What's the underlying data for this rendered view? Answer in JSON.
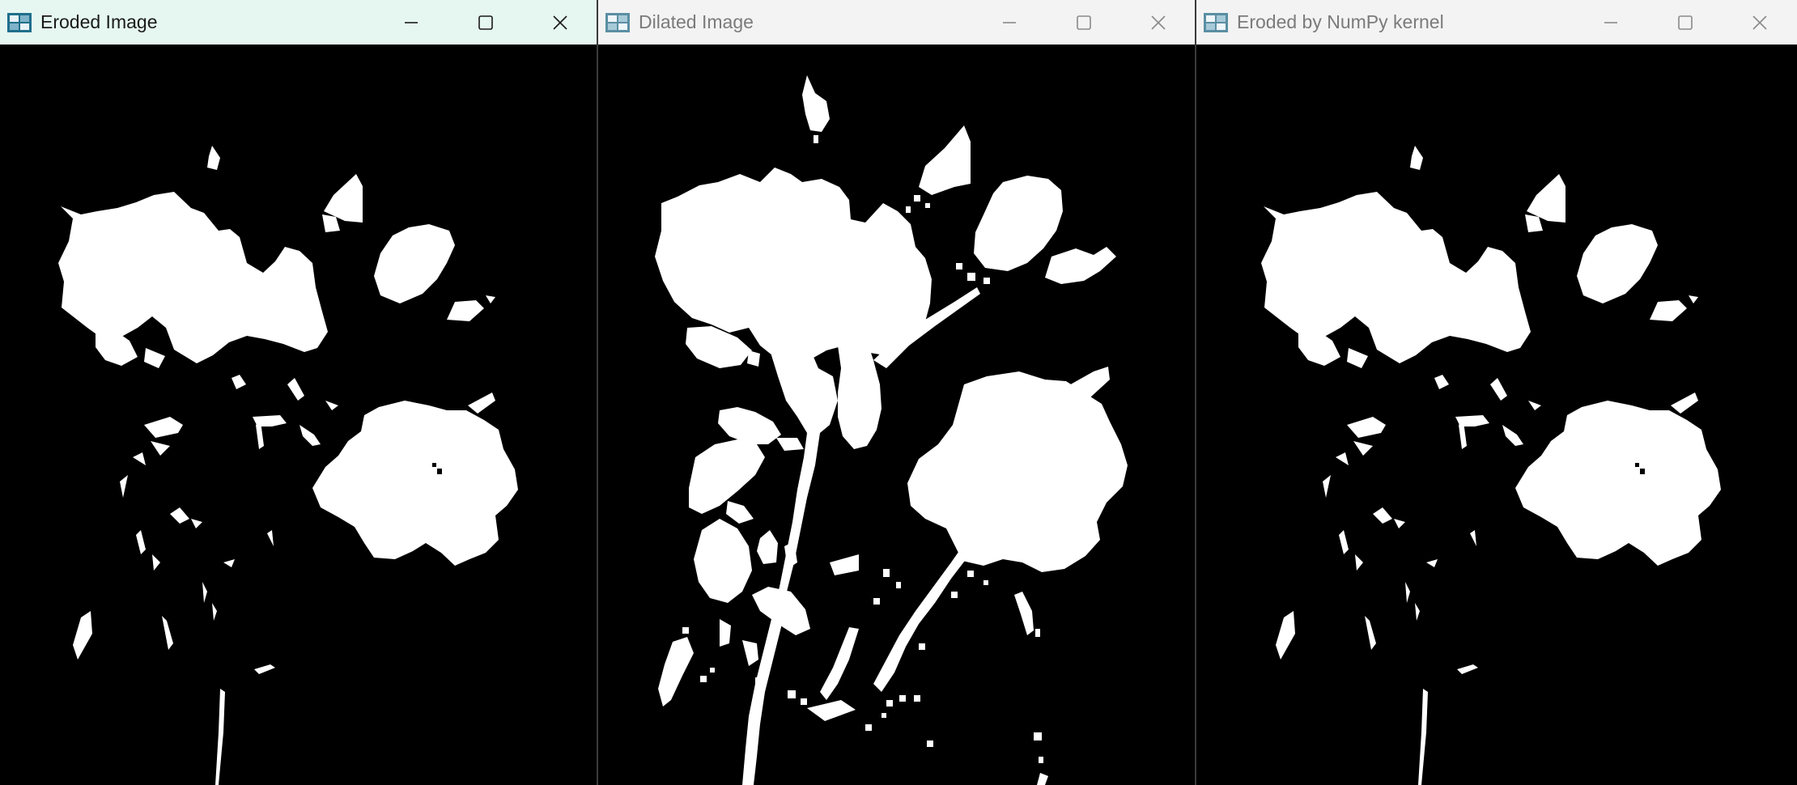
{
  "windows": [
    {
      "title": "Eroded Image",
      "state": "active"
    },
    {
      "title": "Dilated Image",
      "state": "inactive"
    },
    {
      "title": "Eroded by NumPy kernel",
      "state": "inactive"
    }
  ],
  "controls": [
    "minimize-icon",
    "maximize-icon",
    "close-icon"
  ],
  "colors": {
    "active_titlebar": "#e6f7f1",
    "inactive_titlebar": "#f3f3f3",
    "foreground": "#ffffff",
    "background": "#000000"
  }
}
